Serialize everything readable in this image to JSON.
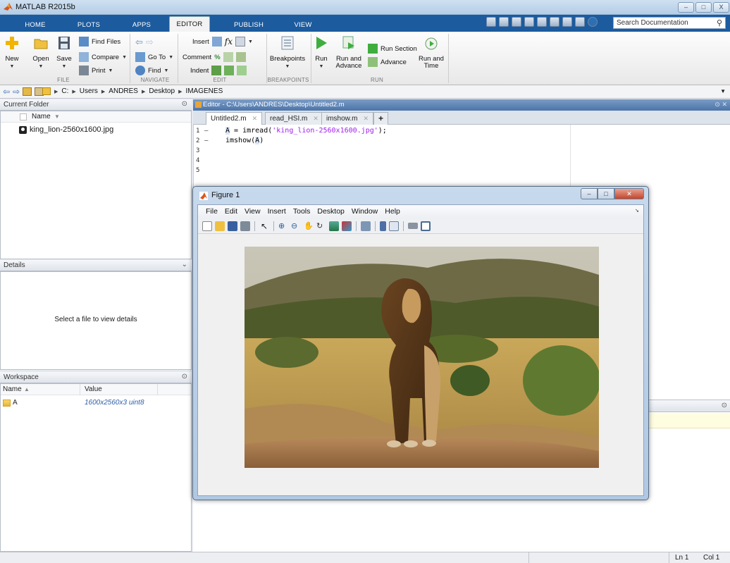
{
  "app": {
    "title": "MATLAB R2015b",
    "window_buttons": [
      "–",
      "□",
      "X"
    ]
  },
  "ribbon": {
    "tabs": [
      {
        "label": "HOME",
        "active": false
      },
      {
        "label": "PLOTS",
        "active": false
      },
      {
        "label": "APPS",
        "active": false
      },
      {
        "label": "EDITOR",
        "active": true
      },
      {
        "label": "PUBLISH",
        "active": false
      },
      {
        "label": "VIEW",
        "active": false
      }
    ],
    "search_placeholder": "Search Documentation",
    "file": {
      "new": "New",
      "open": "Open",
      "save": "Save",
      "find_files": "Find Files",
      "compare": "Compare",
      "print": "Print",
      "group": "FILE"
    },
    "navigate": {
      "go_to": "Go To",
      "find": "Find",
      "group": "NAVIGATE"
    },
    "edit": {
      "insert": "Insert",
      "comment": "Comment",
      "indent": "Indent",
      "group": "EDIT"
    },
    "breakpoints": {
      "label": "Breakpoints",
      "group": "BREAKPOINTS"
    },
    "run": {
      "run": "Run",
      "run_and_advance_1": "Run and",
      "run_and_advance_2": "Advance",
      "run_section": "Run Section",
      "advance": "Advance",
      "run_and_time_1": "Run and",
      "run_and_time_2": "Time",
      "group": "RUN"
    }
  },
  "address": {
    "path": [
      "C:",
      "Users",
      "ANDRES",
      "Desktop",
      "IMAGENES"
    ]
  },
  "current_folder": {
    "title": "Current Folder",
    "column": "Name",
    "files": [
      "king_lion-2560x1600.jpg"
    ]
  },
  "details": {
    "title": "Details",
    "empty_message": "Select a file to view details"
  },
  "workspace": {
    "title": "Workspace",
    "columns": [
      "Name",
      "Value"
    ],
    "rows": [
      {
        "name": "A",
        "value": "1600x2560x3 uint8"
      }
    ]
  },
  "editor": {
    "title": "Editor - C:\\Users\\ANDRES\\Desktop\\Untitled2.m",
    "tabs": [
      {
        "label": "Untitled2.m",
        "active": true
      },
      {
        "label": "read_HSI.m",
        "active": false
      },
      {
        "label": "imshow.m",
        "active": false
      }
    ],
    "add_tab": "+",
    "line_numbers": [
      "1",
      "2",
      "3",
      "4",
      "5"
    ],
    "line_markers": [
      "–",
      "–"
    ],
    "code": {
      "line1_var": "A",
      "line1_op": " = imread(",
      "line1_str": "'king_lion-2560x1600.jpg'",
      "line1_end": ");",
      "line2_fn": "imshow(",
      "line2_var": "A",
      "line2_end": ")"
    }
  },
  "figure": {
    "title": "Figure 1",
    "menu": [
      "File",
      "Edit",
      "View",
      "Insert",
      "Tools",
      "Desktop",
      "Window",
      "Help"
    ],
    "image_subject": "lion standing on a rock in savanna grassland"
  },
  "status": {
    "line": "Ln 1",
    "col": "Col 1"
  },
  "colors": {
    "ribbon_blue": "#1c5b9e",
    "string_purple": "#a020f0",
    "editor_title_blue": "#4c74a8"
  }
}
